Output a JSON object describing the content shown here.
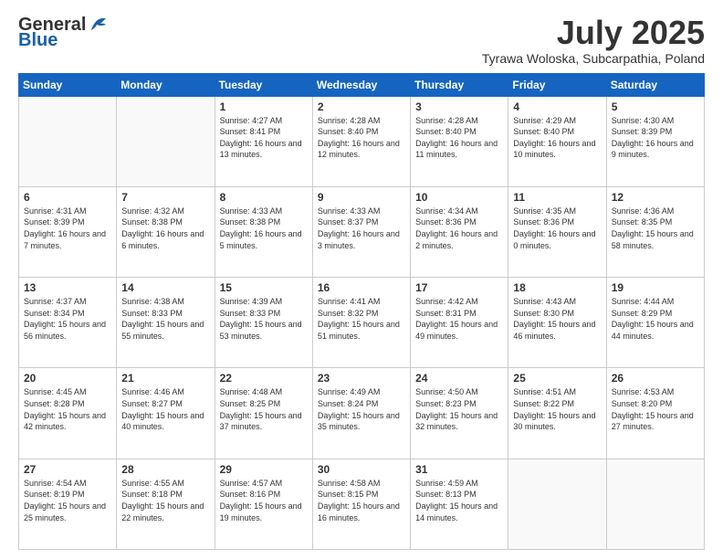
{
  "header": {
    "logo_general": "General",
    "logo_blue": "Blue",
    "month_title": "July 2025",
    "location": "Tyrawa Woloska, Subcarpathia, Poland"
  },
  "days_of_week": [
    "Sunday",
    "Monday",
    "Tuesday",
    "Wednesday",
    "Thursday",
    "Friday",
    "Saturday"
  ],
  "weeks": [
    [
      {
        "day": "",
        "info": ""
      },
      {
        "day": "",
        "info": ""
      },
      {
        "day": "1",
        "info": "Sunrise: 4:27 AM\nSunset: 8:41 PM\nDaylight: 16 hours and 13 minutes."
      },
      {
        "day": "2",
        "info": "Sunrise: 4:28 AM\nSunset: 8:40 PM\nDaylight: 16 hours and 12 minutes."
      },
      {
        "day": "3",
        "info": "Sunrise: 4:28 AM\nSunset: 8:40 PM\nDaylight: 16 hours and 11 minutes."
      },
      {
        "day": "4",
        "info": "Sunrise: 4:29 AM\nSunset: 8:40 PM\nDaylight: 16 hours and 10 minutes."
      },
      {
        "day": "5",
        "info": "Sunrise: 4:30 AM\nSunset: 8:39 PM\nDaylight: 16 hours and 9 minutes."
      }
    ],
    [
      {
        "day": "6",
        "info": "Sunrise: 4:31 AM\nSunset: 8:39 PM\nDaylight: 16 hours and 7 minutes."
      },
      {
        "day": "7",
        "info": "Sunrise: 4:32 AM\nSunset: 8:38 PM\nDaylight: 16 hours and 6 minutes."
      },
      {
        "day": "8",
        "info": "Sunrise: 4:33 AM\nSunset: 8:38 PM\nDaylight: 16 hours and 5 minutes."
      },
      {
        "day": "9",
        "info": "Sunrise: 4:33 AM\nSunset: 8:37 PM\nDaylight: 16 hours and 3 minutes."
      },
      {
        "day": "10",
        "info": "Sunrise: 4:34 AM\nSunset: 8:36 PM\nDaylight: 16 hours and 2 minutes."
      },
      {
        "day": "11",
        "info": "Sunrise: 4:35 AM\nSunset: 8:36 PM\nDaylight: 16 hours and 0 minutes."
      },
      {
        "day": "12",
        "info": "Sunrise: 4:36 AM\nSunset: 8:35 PM\nDaylight: 15 hours and 58 minutes."
      }
    ],
    [
      {
        "day": "13",
        "info": "Sunrise: 4:37 AM\nSunset: 8:34 PM\nDaylight: 15 hours and 56 minutes."
      },
      {
        "day": "14",
        "info": "Sunrise: 4:38 AM\nSunset: 8:33 PM\nDaylight: 15 hours and 55 minutes."
      },
      {
        "day": "15",
        "info": "Sunrise: 4:39 AM\nSunset: 8:33 PM\nDaylight: 15 hours and 53 minutes."
      },
      {
        "day": "16",
        "info": "Sunrise: 4:41 AM\nSunset: 8:32 PM\nDaylight: 15 hours and 51 minutes."
      },
      {
        "day": "17",
        "info": "Sunrise: 4:42 AM\nSunset: 8:31 PM\nDaylight: 15 hours and 49 minutes."
      },
      {
        "day": "18",
        "info": "Sunrise: 4:43 AM\nSunset: 8:30 PM\nDaylight: 15 hours and 46 minutes."
      },
      {
        "day": "19",
        "info": "Sunrise: 4:44 AM\nSunset: 8:29 PM\nDaylight: 15 hours and 44 minutes."
      }
    ],
    [
      {
        "day": "20",
        "info": "Sunrise: 4:45 AM\nSunset: 8:28 PM\nDaylight: 15 hours and 42 minutes."
      },
      {
        "day": "21",
        "info": "Sunrise: 4:46 AM\nSunset: 8:27 PM\nDaylight: 15 hours and 40 minutes."
      },
      {
        "day": "22",
        "info": "Sunrise: 4:48 AM\nSunset: 8:25 PM\nDaylight: 15 hours and 37 minutes."
      },
      {
        "day": "23",
        "info": "Sunrise: 4:49 AM\nSunset: 8:24 PM\nDaylight: 15 hours and 35 minutes."
      },
      {
        "day": "24",
        "info": "Sunrise: 4:50 AM\nSunset: 8:23 PM\nDaylight: 15 hours and 32 minutes."
      },
      {
        "day": "25",
        "info": "Sunrise: 4:51 AM\nSunset: 8:22 PM\nDaylight: 15 hours and 30 minutes."
      },
      {
        "day": "26",
        "info": "Sunrise: 4:53 AM\nSunset: 8:20 PM\nDaylight: 15 hours and 27 minutes."
      }
    ],
    [
      {
        "day": "27",
        "info": "Sunrise: 4:54 AM\nSunset: 8:19 PM\nDaylight: 15 hours and 25 minutes."
      },
      {
        "day": "28",
        "info": "Sunrise: 4:55 AM\nSunset: 8:18 PM\nDaylight: 15 hours and 22 minutes."
      },
      {
        "day": "29",
        "info": "Sunrise: 4:57 AM\nSunset: 8:16 PM\nDaylight: 15 hours and 19 minutes."
      },
      {
        "day": "30",
        "info": "Sunrise: 4:58 AM\nSunset: 8:15 PM\nDaylight: 15 hours and 16 minutes."
      },
      {
        "day": "31",
        "info": "Sunrise: 4:59 AM\nSunset: 8:13 PM\nDaylight: 15 hours and 14 minutes."
      },
      {
        "day": "",
        "info": ""
      },
      {
        "day": "",
        "info": ""
      }
    ]
  ]
}
